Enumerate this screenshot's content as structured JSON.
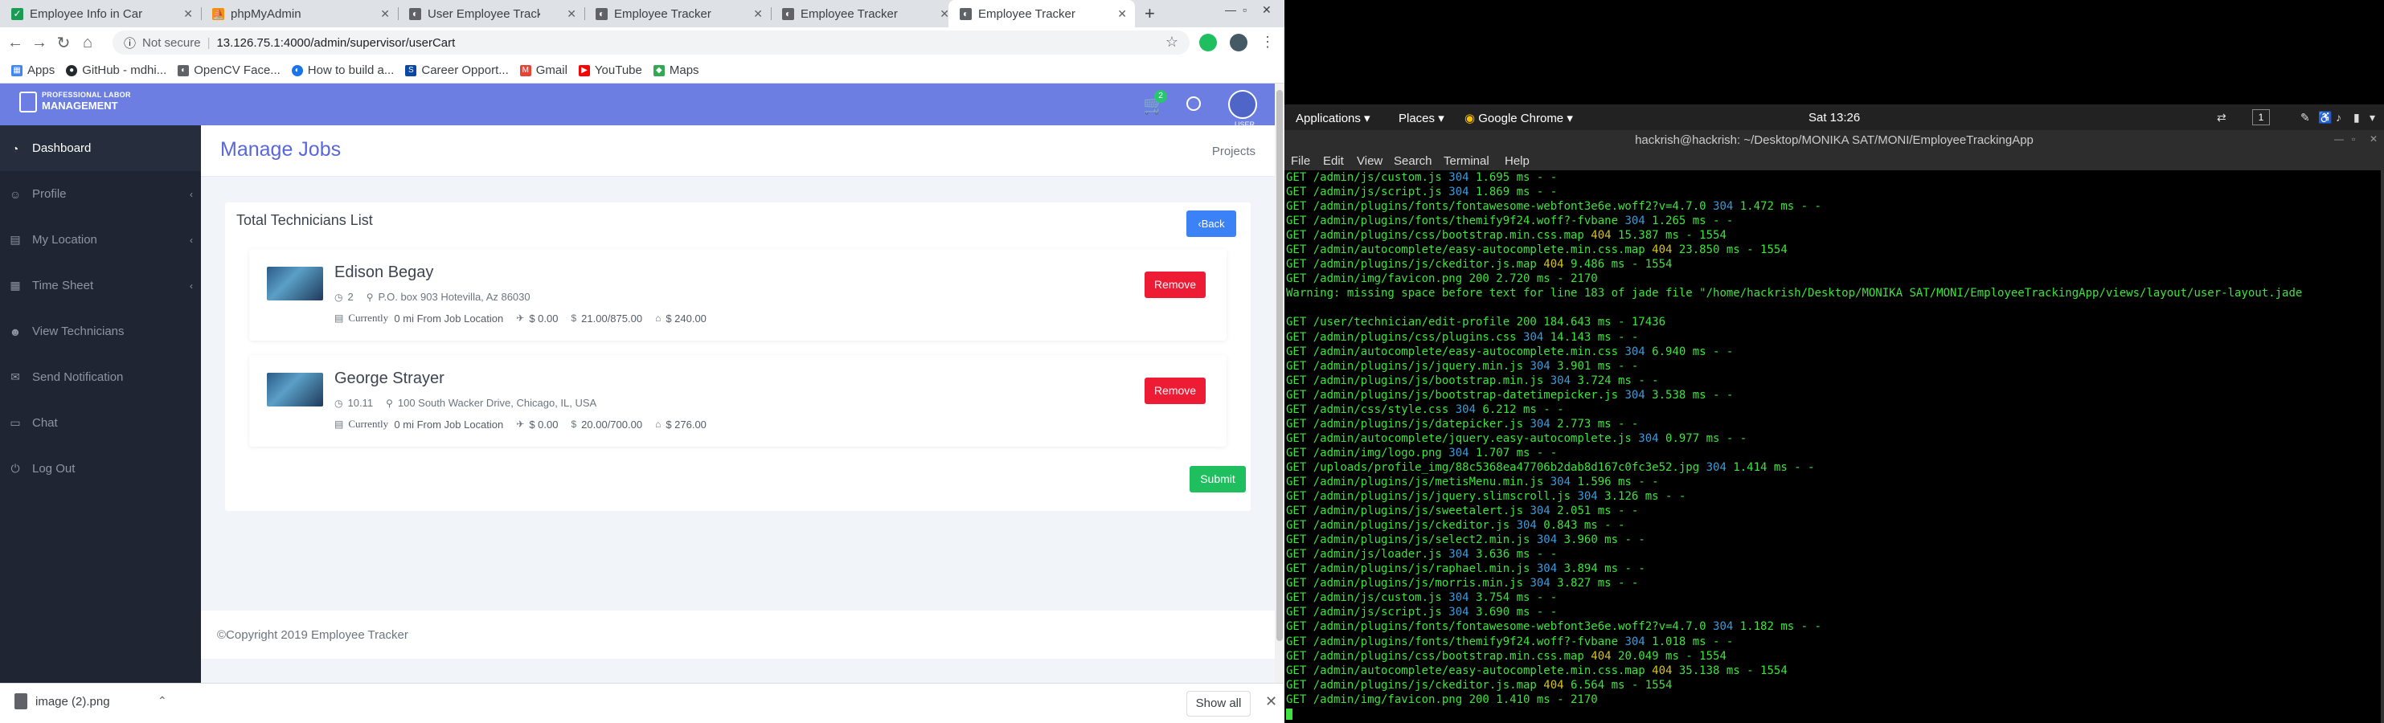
{
  "browser": {
    "tabs": [
      {
        "title": "Employee Info in Cart Ge",
        "icon": "check-icon",
        "color": "#1a9c55"
      },
      {
        "title": "phpMyAdmin",
        "icon": "phpmyadmin-icon",
        "color": "#f29111"
      },
      {
        "title": "User Employee Tracker",
        "icon": "globe-icon",
        "color": "#5f6368"
      },
      {
        "title": "Employee Tracker",
        "icon": "globe-icon",
        "color": "#5f6368"
      },
      {
        "title": "Employee Tracker",
        "icon": "globe-icon",
        "color": "#5f6368"
      },
      {
        "title": "Employee Tracker",
        "icon": "globe-icon",
        "color": "#5f6368"
      }
    ],
    "new_tab": "+",
    "not_secure": "Not secure",
    "url": "13.126.75.1:4000/admin/supervisor/userCart",
    "bookmarks": [
      {
        "label": "Apps",
        "icon": "apps-icon",
        "color": "#4285f4"
      },
      {
        "label": "GitHub - mdhi...",
        "icon": "github-icon",
        "color": "#24292e"
      },
      {
        "label": "OpenCV Face...",
        "icon": "globe-icon",
        "color": "#5f6368"
      },
      {
        "label": "How to build a...",
        "icon": "globe-icon",
        "color": "#1a73e8"
      },
      {
        "label": "Career Opport...",
        "icon": "sf-icon",
        "color": "#0d47a1"
      },
      {
        "label": "Gmail",
        "icon": "gmail-icon",
        "color": "#ea4335"
      },
      {
        "label": "YouTube",
        "icon": "youtube-icon",
        "color": "#ff0000"
      },
      {
        "label": "Maps",
        "icon": "maps-icon",
        "color": "#34a853"
      }
    ],
    "download": {
      "file": "image (2).png",
      "show_all": "Show all"
    }
  },
  "app": {
    "brand_line1": "PROFESSIONAL LABOR",
    "brand_line2": "MANAGEMENT",
    "cart_count": "2",
    "user_label": "USER",
    "accent": "#6c7ee1",
    "sidebar": [
      {
        "label": "Dashboard",
        "icon": "dashboard-icon",
        "chevron": false
      },
      {
        "label": "Profile",
        "icon": "user-icon",
        "chevron": true
      },
      {
        "label": "My Location",
        "icon": "map-icon",
        "chevron": true
      },
      {
        "label": "Time Sheet",
        "icon": "calendar-icon",
        "chevron": true
      },
      {
        "label": "View Technicians",
        "icon": "users-icon",
        "chevron": false
      },
      {
        "label": "Send Notification",
        "icon": "bell-icon",
        "chevron": false
      },
      {
        "label": "Chat",
        "icon": "chat-icon",
        "chevron": false
      },
      {
        "label": "Log Out",
        "icon": "logout-icon",
        "chevron": false
      }
    ],
    "page_title": "Manage Jobs",
    "breadcrumb": "Projects",
    "card_title": "Total Technicians List",
    "back_label": "Back",
    "technicians": [
      {
        "name": "Edison Begay",
        "time": "2",
        "address": "P.O. box 903 Hotevilla, Az 86030",
        "currently": "Currently",
        "distance": "0 mi From Job Location",
        "flight": "$ 0.00",
        "rate": "21.00/875.00",
        "total": "$ 240.00",
        "remove_label": "Remove"
      },
      {
        "name": "George Strayer",
        "time": "10.11",
        "address": "100 South Wacker Drive, Chicago, IL, USA",
        "currently": "Currently",
        "distance": "0 mi From Job Location",
        "flight": "$ 0.00",
        "rate": "20.00/700.00",
        "total": "$ 276.00",
        "remove_label": "Remove"
      }
    ],
    "submit_label": "Submit",
    "copyright": "©Copyright 2019 Employee Tracker"
  },
  "desktop": {
    "menus": [
      "Applications",
      "Places",
      "Google Chrome"
    ],
    "clock": "Sat 13:26",
    "workspace": "1",
    "terminal_title": "hackrish@hackrish: ~/Desktop/MONIKA SAT/MONI/EmployeeTrackingApp",
    "terminal_menu": [
      "File",
      "Edit",
      "View",
      "Search",
      "Terminal",
      "Help"
    ],
    "log": [
      [
        [
          "GET /admin/js/custom.js ",
          "g"
        ],
        [
          "304",
          "c"
        ],
        [
          " 1.695 ms - -",
          "g"
        ]
      ],
      [
        [
          "GET /admin/js/script.js ",
          "g"
        ],
        [
          "304",
          "c"
        ],
        [
          " 1.869 ms - -",
          "g"
        ]
      ],
      [
        [
          "GET /admin/plugins/fonts/fontawesome-webfont3e6e.woff2?v=4.7.0 ",
          "g"
        ],
        [
          "304",
          "c"
        ],
        [
          " 1.472 ms - -",
          "g"
        ]
      ],
      [
        [
          "GET /admin/plugins/fonts/themify9f24.woff?-fvbane ",
          "g"
        ],
        [
          "304",
          "c"
        ],
        [
          " 1.265 ms - -",
          "g"
        ]
      ],
      [
        [
          "GET /admin/plugins/css/bootstrap.min.css.map ",
          "g"
        ],
        [
          "404",
          "y"
        ],
        [
          " 15.387 ms - 1554",
          "g"
        ]
      ],
      [
        [
          "GET /admin/autocomplete/easy-autocomplete.min.css.map ",
          "g"
        ],
        [
          "404",
          "y"
        ],
        [
          " 23.850 ms - 1554",
          "g"
        ]
      ],
      [
        [
          "GET /admin/plugins/js/ckeditor.js.map ",
          "g"
        ],
        [
          "404",
          "y"
        ],
        [
          " 9.486 ms - 1554",
          "g"
        ]
      ],
      [
        [
          "GET /admin/img/favicon.png 200 2.720 ms - 2170",
          "g"
        ]
      ],
      [
        [
          "Warning: missing space before text for line 183 of jade file \"/home/hackrish/Desktop/MONIKA SAT/MONI/EmployeeTrackingApp/views/layout/user-layout.jade",
          "g"
        ]
      ],
      [
        [
          "",
          "g"
        ]
      ],
      [
        [
          "GET /user/technician/edit-profile 200 184.643 ms - 17436",
          "g"
        ]
      ],
      [
        [
          "GET /admin/plugins/css/plugins.css ",
          "g"
        ],
        [
          "304",
          "c"
        ],
        [
          " 14.143 ms - -",
          "g"
        ]
      ],
      [
        [
          "GET /admin/autocomplete/easy-autocomplete.min.css ",
          "g"
        ],
        [
          "304",
          "c"
        ],
        [
          " 6.940 ms - -",
          "g"
        ]
      ],
      [
        [
          "GET /admin/plugins/js/jquery.min.js ",
          "g"
        ],
        [
          "304",
          "c"
        ],
        [
          " 3.901 ms - -",
          "g"
        ]
      ],
      [
        [
          "GET /admin/plugins/js/bootstrap.min.js ",
          "g"
        ],
        [
          "304",
          "c"
        ],
        [
          " 3.724 ms - -",
          "g"
        ]
      ],
      [
        [
          "GET /admin/plugins/js/bootstrap-datetimepicker.js ",
          "g"
        ],
        [
          "304",
          "c"
        ],
        [
          " 3.538 ms - -",
          "g"
        ]
      ],
      [
        [
          "GET /admin/css/style.css ",
          "g"
        ],
        [
          "304",
          "c"
        ],
        [
          " 6.212 ms - -",
          "g"
        ]
      ],
      [
        [
          "GET /admin/plugins/js/datepicker.js ",
          "g"
        ],
        [
          "304",
          "c"
        ],
        [
          " 2.773 ms - -",
          "g"
        ]
      ],
      [
        [
          "GET /admin/autocomplete/jquery.easy-autocomplete.js ",
          "g"
        ],
        [
          "304",
          "c"
        ],
        [
          " 0.977 ms - -",
          "g"
        ]
      ],
      [
        [
          "GET /admin/img/logo.png ",
          "g"
        ],
        [
          "304",
          "c"
        ],
        [
          " 1.707 ms - -",
          "g"
        ]
      ],
      [
        [
          "GET /uploads/profile_img/88c5368ea47706b2dab8d167c0fc3e52.jpg ",
          "g"
        ],
        [
          "304",
          "c"
        ],
        [
          " 1.414 ms - -",
          "g"
        ]
      ],
      [
        [
          "GET /admin/plugins/js/metisMenu.min.js ",
          "g"
        ],
        [
          "304",
          "c"
        ],
        [
          " 1.596 ms - -",
          "g"
        ]
      ],
      [
        [
          "GET /admin/plugins/js/jquery.slimscroll.js ",
          "g"
        ],
        [
          "304",
          "c"
        ],
        [
          " 3.126 ms - -",
          "g"
        ]
      ],
      [
        [
          "GET /admin/plugins/js/sweetalert.js ",
          "g"
        ],
        [
          "304",
          "c"
        ],
        [
          " 2.051 ms - -",
          "g"
        ]
      ],
      [
        [
          "GET /admin/plugins/js/ckeditor.js ",
          "g"
        ],
        [
          "304",
          "c"
        ],
        [
          " 0.843 ms - -",
          "g"
        ]
      ],
      [
        [
          "GET /admin/plugins/js/select2.min.js ",
          "g"
        ],
        [
          "304",
          "c"
        ],
        [
          " 3.960 ms - -",
          "g"
        ]
      ],
      [
        [
          "GET /admin/js/loader.js ",
          "g"
        ],
        [
          "304",
          "c"
        ],
        [
          " 3.636 ms - -",
          "g"
        ]
      ],
      [
        [
          "GET /admin/plugins/js/raphael.min.js ",
          "g"
        ],
        [
          "304",
          "c"
        ],
        [
          " 3.894 ms - -",
          "g"
        ]
      ],
      [
        [
          "GET /admin/plugins/js/morris.min.js ",
          "g"
        ],
        [
          "304",
          "c"
        ],
        [
          " 3.827 ms - -",
          "g"
        ]
      ],
      [
        [
          "GET /admin/js/custom.js ",
          "g"
        ],
        [
          "304",
          "c"
        ],
        [
          " 3.754 ms - -",
          "g"
        ]
      ],
      [
        [
          "GET /admin/js/script.js ",
          "g"
        ],
        [
          "304",
          "c"
        ],
        [
          " 3.690 ms - -",
          "g"
        ]
      ],
      [
        [
          "GET /admin/plugins/fonts/fontawesome-webfont3e6e.woff2?v=4.7.0 ",
          "g"
        ],
        [
          "304",
          "c"
        ],
        [
          " 1.182 ms - -",
          "g"
        ]
      ],
      [
        [
          "GET /admin/plugins/fonts/themify9f24.woff?-fvbane ",
          "g"
        ],
        [
          "304",
          "c"
        ],
        [
          " 1.018 ms - -",
          "g"
        ]
      ],
      [
        [
          "GET /admin/plugins/css/bootstrap.min.css.map ",
          "g"
        ],
        [
          "404",
          "y"
        ],
        [
          " 20.049 ms - 1554",
          "g"
        ]
      ],
      [
        [
          "GET /admin/autocomplete/easy-autocomplete.min.css.map ",
          "g"
        ],
        [
          "404",
          "y"
        ],
        [
          " 35.138 ms - 1554",
          "g"
        ]
      ],
      [
        [
          "GET /admin/plugins/js/ckeditor.js.map ",
          "g"
        ],
        [
          "404",
          "y"
        ],
        [
          " 6.564 ms - 1554",
          "g"
        ]
      ],
      [
        [
          "GET /admin/img/favicon.png 200 1.410 ms - 2170",
          "g"
        ]
      ]
    ]
  }
}
